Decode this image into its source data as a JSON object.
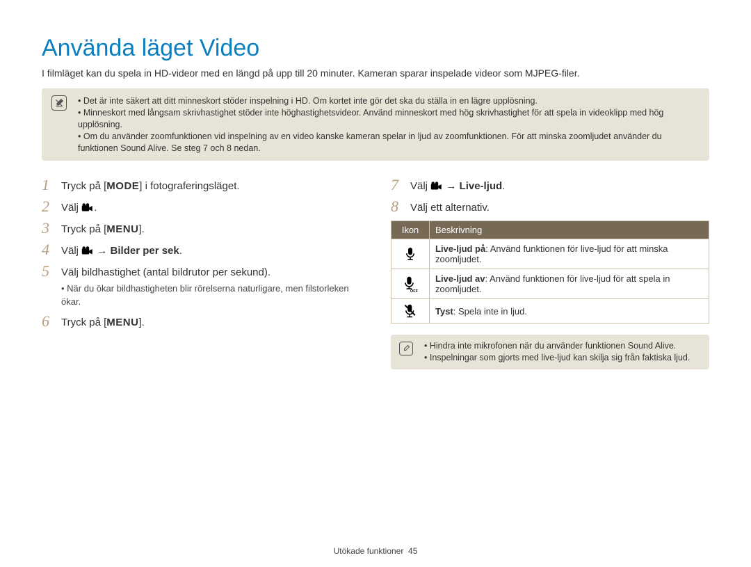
{
  "title": "Använda läget Video",
  "intro": "I filmläget kan du spela in HD-videor med en längd på upp till 20 minuter. Kameran sparar inspelade videor som MJPEG-filer.",
  "note1": {
    "items": [
      "Det är inte säkert att ditt minneskort stöder inspelning i HD. Om kortet inte gör det ska du ställa in en lägre upplösning.",
      "Minneskort med långsam skrivhastighet stöder inte höghastighetsvideor. Använd minneskort med hög skrivhastighet för att spela in videoklipp med hög upplösning.",
      "Om du använder zoomfunktionen vid inspelning av en video kanske kameran spelar in ljud av zoomfunktionen. För att minska zoomljudet använder du funktionen Sound Alive. Se steg 7 och 8 nedan."
    ]
  },
  "labels": {
    "mode": "MODE",
    "menu": "MENU"
  },
  "steps_left": [
    {
      "n": "1",
      "pre": "Tryck på [",
      "key": "MODE",
      "post": "] i fotograferingsläget."
    },
    {
      "n": "2",
      "pre": "Välj ",
      "icon": "camcorder",
      "post": "."
    },
    {
      "n": "3",
      "pre": "Tryck på [",
      "key": "MENU",
      "post": "]."
    },
    {
      "n": "4",
      "pre": "Välj ",
      "icon": "camcorder",
      "arrow": "→",
      "bold": "Bilder per sek",
      "post": "."
    },
    {
      "n": "5",
      "pre": "Välj bildhastighet (antal bildrutor per sekund).",
      "sub": "När du ökar bildhastigheten blir rörelserna naturligare, men filstorleken ökar."
    },
    {
      "n": "6",
      "pre": "Tryck på [",
      "key": "MENU",
      "post": "]."
    }
  ],
  "steps_right": [
    {
      "n": "7",
      "pre": "Välj ",
      "icon": "camcorder",
      "arrow": "→",
      "bold": "Live-ljud",
      "post": "."
    },
    {
      "n": "8",
      "pre": "Välj ett alternativ."
    }
  ],
  "table": {
    "headers": [
      "Ikon",
      "Beskrivning"
    ],
    "rows": [
      {
        "icon": "mic-on",
        "label": "Live-ljud på",
        "desc": ": Använd funktionen för live-ljud för att minska zoomljudet."
      },
      {
        "icon": "mic-off",
        "label": "Live-ljud av",
        "desc": ": Använd funktionen för live-ljud för att spela in zoomljudet."
      },
      {
        "icon": "mute",
        "label": "Tyst",
        "desc": ": Spela inte in ljud."
      }
    ]
  },
  "note2": {
    "items": [
      "Hindra inte mikrofonen när du använder funktionen Sound Alive.",
      "Inspelningar som gjorts med live-ljud kan skilja sig från faktiska ljud."
    ]
  },
  "footer": {
    "section": "Utökade funktioner",
    "page": "45"
  }
}
